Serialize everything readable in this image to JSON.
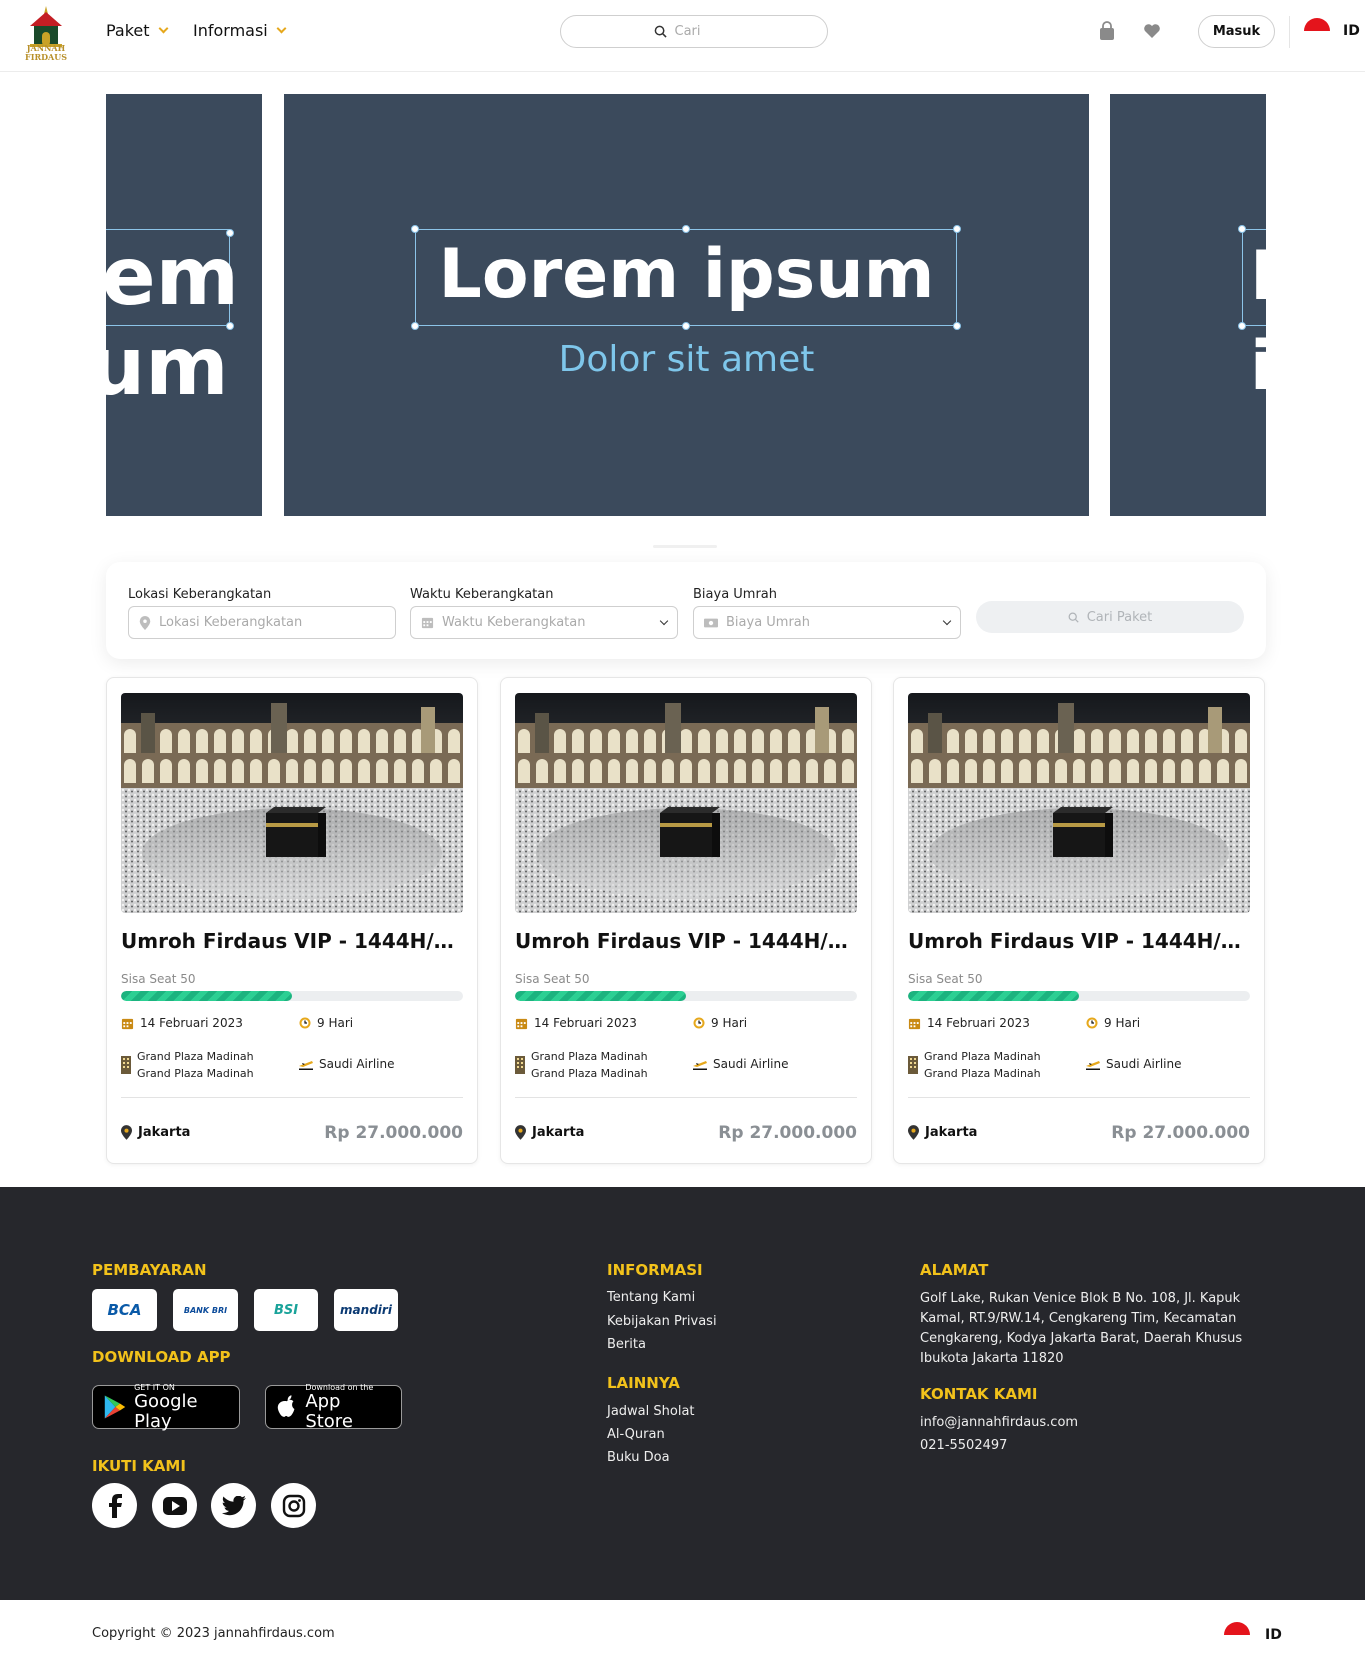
{
  "brand": {
    "logo_line1": "JANNAH",
    "logo_line2": "FIRDAUS"
  },
  "nav": {
    "menu": [
      {
        "label": "Paket"
      },
      {
        "label": "Informasi"
      }
    ],
    "search_placeholder": "Cari",
    "login_label": "Masuk",
    "language": "ID",
    "icons": {
      "cart": "shopping-bag-icon",
      "wishlist": "heart-icon",
      "search": "search-icon"
    }
  },
  "hero": {
    "title": "Lorem ipsum",
    "subtitle": "Dolor sit amet",
    "colors": {
      "background": "#3b4a5c",
      "title": "#ffffff",
      "subtitle": "#7ec6ea"
    }
  },
  "filter": {
    "location": {
      "label": "Lokasi Keberangkatan",
      "placeholder": "Lokasi Keberangkatan"
    },
    "date": {
      "label": "Waktu Keberangkatan",
      "placeholder": "Waktu Keberangkatan"
    },
    "cost": {
      "label": "Biaya Umrah",
      "placeholder": "Biaya Umrah"
    },
    "search_button": "Cari Paket"
  },
  "packages": [
    {
      "title": "Umroh Firdaus VIP - 1444H/20...",
      "seat_label": "Sisa Seat 50",
      "seat_fill_fraction": 0.5,
      "date": "14 Februari 2023",
      "duration": "9 Hari",
      "hotel_line1": "Grand Plaza Madinah",
      "hotel_line2": "Grand Plaza Madinah",
      "airline": "Saudi Airline",
      "city": "Jakarta",
      "price": "Rp 27.000.000"
    },
    {
      "title": "Umroh Firdaus VIP - 1444H/20...",
      "seat_label": "Sisa Seat 50",
      "seat_fill_fraction": 0.5,
      "date": "14 Februari 2023",
      "duration": "9 Hari",
      "hotel_line1": "Grand Plaza Madinah",
      "hotel_line2": "Grand Plaza Madinah",
      "airline": "Saudi Airline",
      "city": "Jakarta",
      "price": "Rp 27.000.000"
    },
    {
      "title": "Umroh Firdaus VIP - 1444H/20...",
      "seat_label": "Sisa Seat 50",
      "seat_fill_fraction": 0.5,
      "date": "14 Februari 2023",
      "duration": "9 Hari",
      "hotel_line1": "Grand Plaza Madinah",
      "hotel_line2": "Grand Plaza Madinah",
      "airline": "Saudi Airline",
      "city": "Jakarta",
      "price": "Rp 27.000.000"
    }
  ],
  "footer": {
    "payment_heading": "PEMBAYARAN",
    "banks": [
      {
        "name": "BCA"
      },
      {
        "name": "BANK BRI"
      },
      {
        "name": "BSI"
      },
      {
        "name": "mandiri"
      }
    ],
    "download_heading": "DOWNLOAD APP",
    "google_play": {
      "small": "GET IT ON",
      "big": "Google Play"
    },
    "app_store": {
      "small": "Download on the",
      "big": "App Store"
    },
    "follow_heading": "IKUTI KAMI",
    "socials": [
      "facebook-icon",
      "youtube-icon",
      "twitter-icon",
      "instagram-icon"
    ],
    "info_heading": "INFORMASI",
    "info_links": [
      "Tentang Kami",
      "Kebijakan Privasi",
      "Berita"
    ],
    "other_heading": "LAINNYA",
    "other_links": [
      "Jadwal Sholat",
      "Al-Quran",
      "Buku Doa"
    ],
    "address_heading": "ALAMAT",
    "address": "Golf Lake, Rukan Venice Blok B No. 108, Jl. Kapuk Kamal, RT.9/RW.14, Cengkareng Tim, Kecamatan Cengkareng, Kodya Jakarta Barat, Daerah Khusus Ibukota Jakarta 11820",
    "contact_heading": "KONTAK KAMI",
    "email": "info@jannahfirdaus.com",
    "phone": "021-5502497",
    "colors": {
      "background": "#26272c",
      "heading": "#f2c21b"
    }
  },
  "copyright": {
    "text": "Copyright © 2023 jannahfirdaus.com",
    "language": "ID"
  },
  "colors": {
    "accent": "#e6a81c",
    "progress": "#1cb37f"
  }
}
